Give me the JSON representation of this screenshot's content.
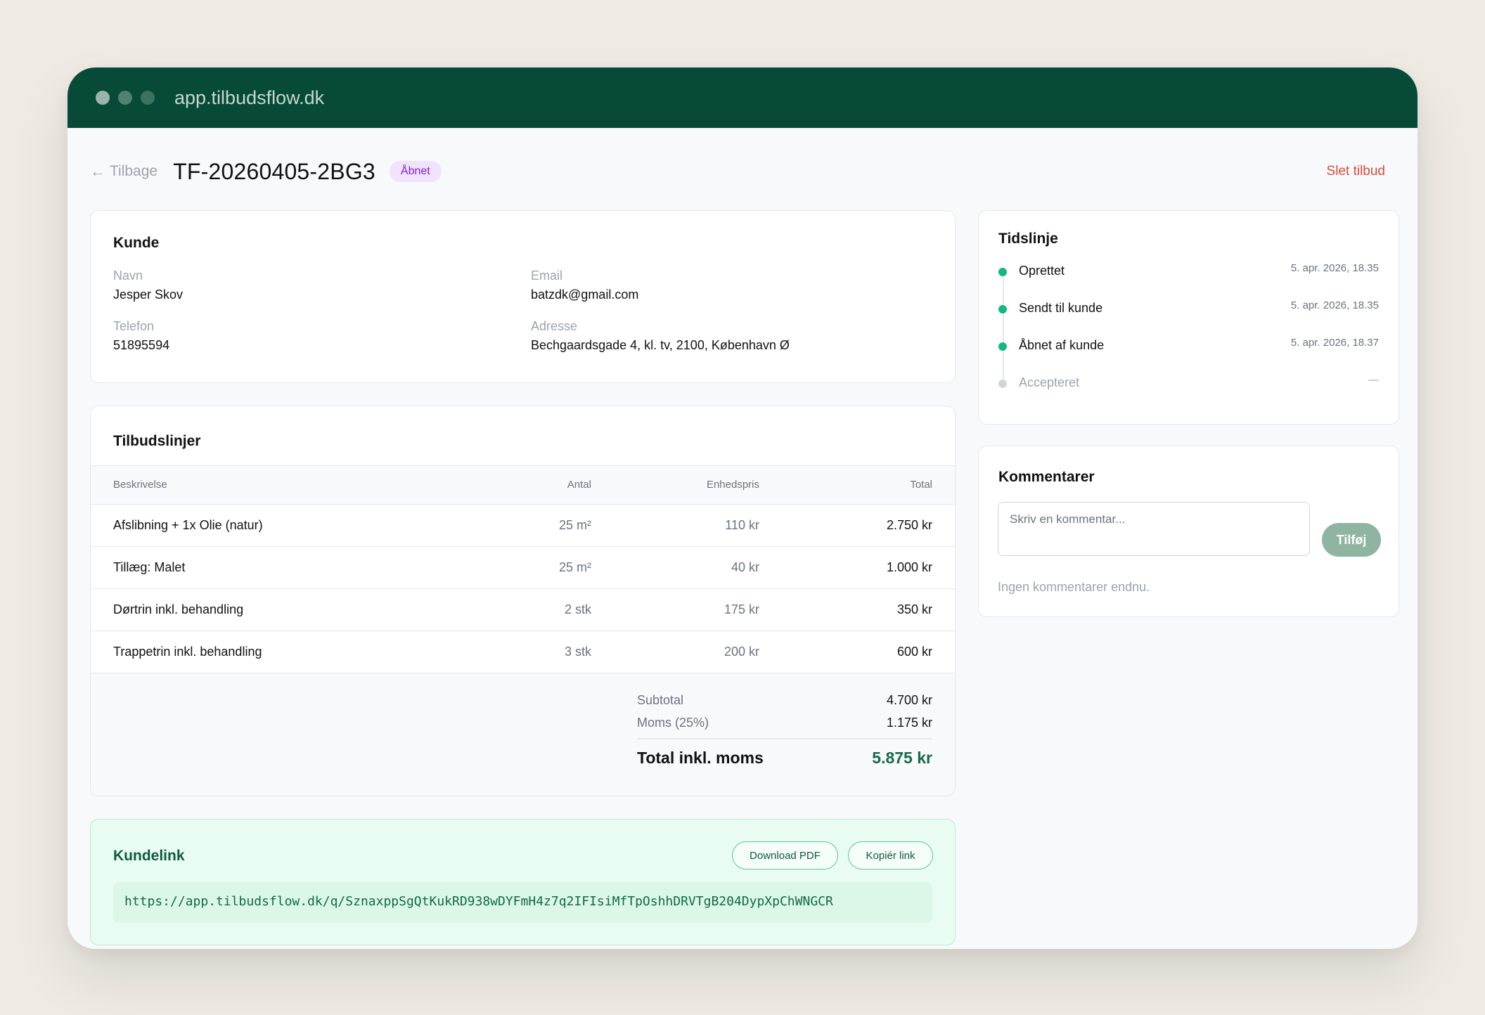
{
  "browser": {
    "url": "app.tilbudsflow.dk"
  },
  "header": {
    "back_label": "Tilbage",
    "reference": "TF-20260405-2BG3",
    "status_badge": "Åbnet",
    "delete_label": "Slet tilbud"
  },
  "customer": {
    "title": "Kunde",
    "name_label": "Navn",
    "name": "Jesper Skov",
    "email_label": "Email",
    "email": "batzdk@gmail.com",
    "phone_label": "Telefon",
    "phone": "51895594",
    "address_label": "Adresse",
    "address": "Bechgaardsgade 4, kl. tv, 2100, København Ø"
  },
  "lines": {
    "title": "Tilbudslinjer",
    "headers": {
      "description": "Beskrivelse",
      "quantity": "Antal",
      "unit_price": "Enhedspris",
      "total": "Total"
    },
    "rows": [
      {
        "description": "Afslibning + 1x Olie (natur)",
        "quantity": "25 m²",
        "unit_price": "110 kr",
        "total": "2.750 kr"
      },
      {
        "description": "Tillæg: Malet",
        "quantity": "25 m²",
        "unit_price": "40 kr",
        "total": "1.000 kr"
      },
      {
        "description": "Dørtrin inkl. behandling",
        "quantity": "2 stk",
        "unit_price": "175 kr",
        "total": "350 kr"
      },
      {
        "description": "Trappetrin inkl. behandling",
        "quantity": "3 stk",
        "unit_price": "200 kr",
        "total": "600 kr"
      }
    ],
    "subtotal_label": "Subtotal",
    "subtotal": "4.700 kr",
    "vat_label": "Moms (25%)",
    "vat": "1.175 kr",
    "grand_total_label": "Total inkl. moms",
    "grand_total": "5.875 kr"
  },
  "customer_link": {
    "title": "Kundelink",
    "download_label": "Download PDF",
    "copy_label": "Kopiér link",
    "url": "https://app.tilbudsflow.dk/q/SznaxppSgQtKukRD938wDYFmH4z7q2IFIsiMfTpOshhDRVTgB204DypXpChWNGCR"
  },
  "timeline": {
    "title": "Tidslinje",
    "events": [
      {
        "label": "Oprettet",
        "time": "5. apr. 2026, 18.35",
        "done": true
      },
      {
        "label": "Sendt til kunde",
        "time": "5. apr. 2026, 18.35",
        "done": true
      },
      {
        "label": "Åbnet af kunde",
        "time": "5. apr. 2026, 18.37",
        "done": true
      },
      {
        "label": "Accepteret",
        "time": "—",
        "done": false
      }
    ]
  },
  "comments": {
    "title": "Kommentarer",
    "placeholder": "Skriv en kommentar...",
    "add_label": "Tilføj",
    "empty_text": "Ingen kommentarer endnu."
  },
  "colors": {
    "brand": "#064a37",
    "accent_green": "#10b981",
    "danger": "#dc4a3a",
    "badge_purple": "#7e22ce"
  }
}
